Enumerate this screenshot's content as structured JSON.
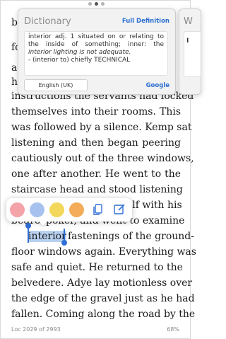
{
  "page_indicator": {
    "count": 3,
    "active_index": 1
  },
  "book": {
    "lines": [
      {
        "id": "l1",
        "text": "b"
      },
      {
        "id": "l2",
        "text": "fo"
      },
      {
        "id": "l3",
        "text": "a"
      },
      {
        "id": "l4",
        "text": "h"
      },
      {
        "id": "l5",
        "text": "instructions the servants had locked"
      },
      {
        "id": "l6",
        "text": "themselves into their rooms. This"
      },
      {
        "id": "l7",
        "text": "was followed by a silence. Kemp sat"
      },
      {
        "id": "l8",
        "text": "listening and then began peering"
      },
      {
        "id": "l9",
        "text": "cautiously out of the three windows,"
      },
      {
        "id": "l10",
        "text": "one after another. He went to the"
      },
      {
        "id": "l11",
        "text": "staircase head and stood listening"
      },
      {
        "id": "l12",
        "text": "elf with his"
      },
      {
        "id": "l13_start",
        "text": "bedroo"
      },
      {
        "id": "l13_end",
        "text": "poker, and went to examine"
      },
      {
        "id": "l14_highlight",
        "text": "interior"
      },
      {
        "id": "l14_rest",
        "text": "fastenings of the ground-"
      },
      {
        "id": "l15",
        "text": "floor windows again. Everything was"
      },
      {
        "id": "l16",
        "text": "safe and quiet. He returned to the"
      },
      {
        "id": "l17",
        "text": "belvedere. Adye lay motionless over"
      },
      {
        "id": "l18",
        "text": "the edge of the gravel just as he had"
      },
      {
        "id": "l19",
        "text": "fallen. Coming along the road by the"
      }
    ]
  },
  "dictionary": {
    "title": "Dictionary",
    "full_definition": "Full Definition",
    "definition_lines": [
      "interior adj. 1 situated on or relating to",
      "the inside of something; inner: the",
      "interior lighting is not adequate.",
      "- (interior to) chiefly TECHNICAL"
    ],
    "language_button": "English (UK)",
    "google_link": "Google"
  },
  "second_card": {
    "title": "W",
    "body_char": "I"
  },
  "highlight_toolbar": {
    "colors": [
      "#f4a3a8",
      "#a8c2ef",
      "#f2d75a",
      "#f5ac5a"
    ],
    "icons": [
      "copy-icon",
      "note-edit-icon"
    ]
  },
  "footer": {
    "location": "Loc 2029 of 2993",
    "percent": "68%"
  }
}
